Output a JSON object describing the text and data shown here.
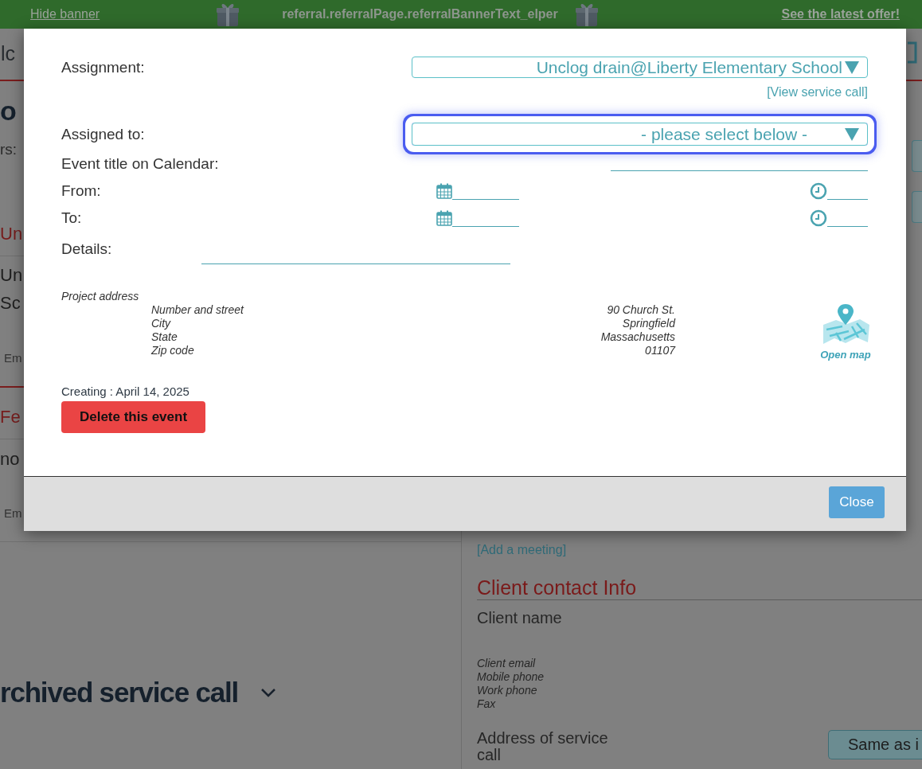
{
  "banner": {
    "hide_link": "Hide banner",
    "text": "referral.referralPage.referralBannerText_elper",
    "offer_link": "See the latest offer!"
  },
  "background": {
    "left": [
      "lc",
      "o",
      "rs:",
      "Un",
      "Un",
      "Sc",
      "Em",
      "Fe",
      "no",
      "Em"
    ],
    "archived_heading": "rchived service call",
    "add_meeting_link": "[Add a meeting]",
    "contact_heading": "Client contact Info",
    "client_name_label": "Client name",
    "contact_fields": [
      "Client email",
      "Mobile phone",
      "Work phone",
      "Fax"
    ],
    "address_label": "Address of service call",
    "same_as_button": "Same as i"
  },
  "modal": {
    "fields": [
      {
        "kind": "select",
        "label": "Assignment:",
        "value": "Unclog drain@Liberty Elementary School",
        "focused": false
      },
      {
        "kind": "link",
        "text": "[View service call]"
      },
      {
        "kind": "select",
        "label": "Assigned to:",
        "value": "- please select below -",
        "focused": true
      },
      {
        "kind": "text",
        "label": "Event title on Calendar:"
      },
      {
        "kind": "datetime",
        "label": "From:"
      },
      {
        "kind": "datetime",
        "label": "To:"
      },
      {
        "kind": "details",
        "label": "Details:"
      }
    ],
    "address": {
      "title": "Project address",
      "rows": [
        {
          "label": "Number and street",
          "value": "90 Church St."
        },
        {
          "label": "City",
          "value": "Springfield"
        },
        {
          "label": "State",
          "value": "Massachusetts"
        },
        {
          "label": "Zip code",
          "value": "01107"
        }
      ],
      "map_link": "Open map"
    },
    "created": "Creating : April 14, 2025",
    "delete_button": "Delete this event",
    "close_button": "Close"
  }
}
